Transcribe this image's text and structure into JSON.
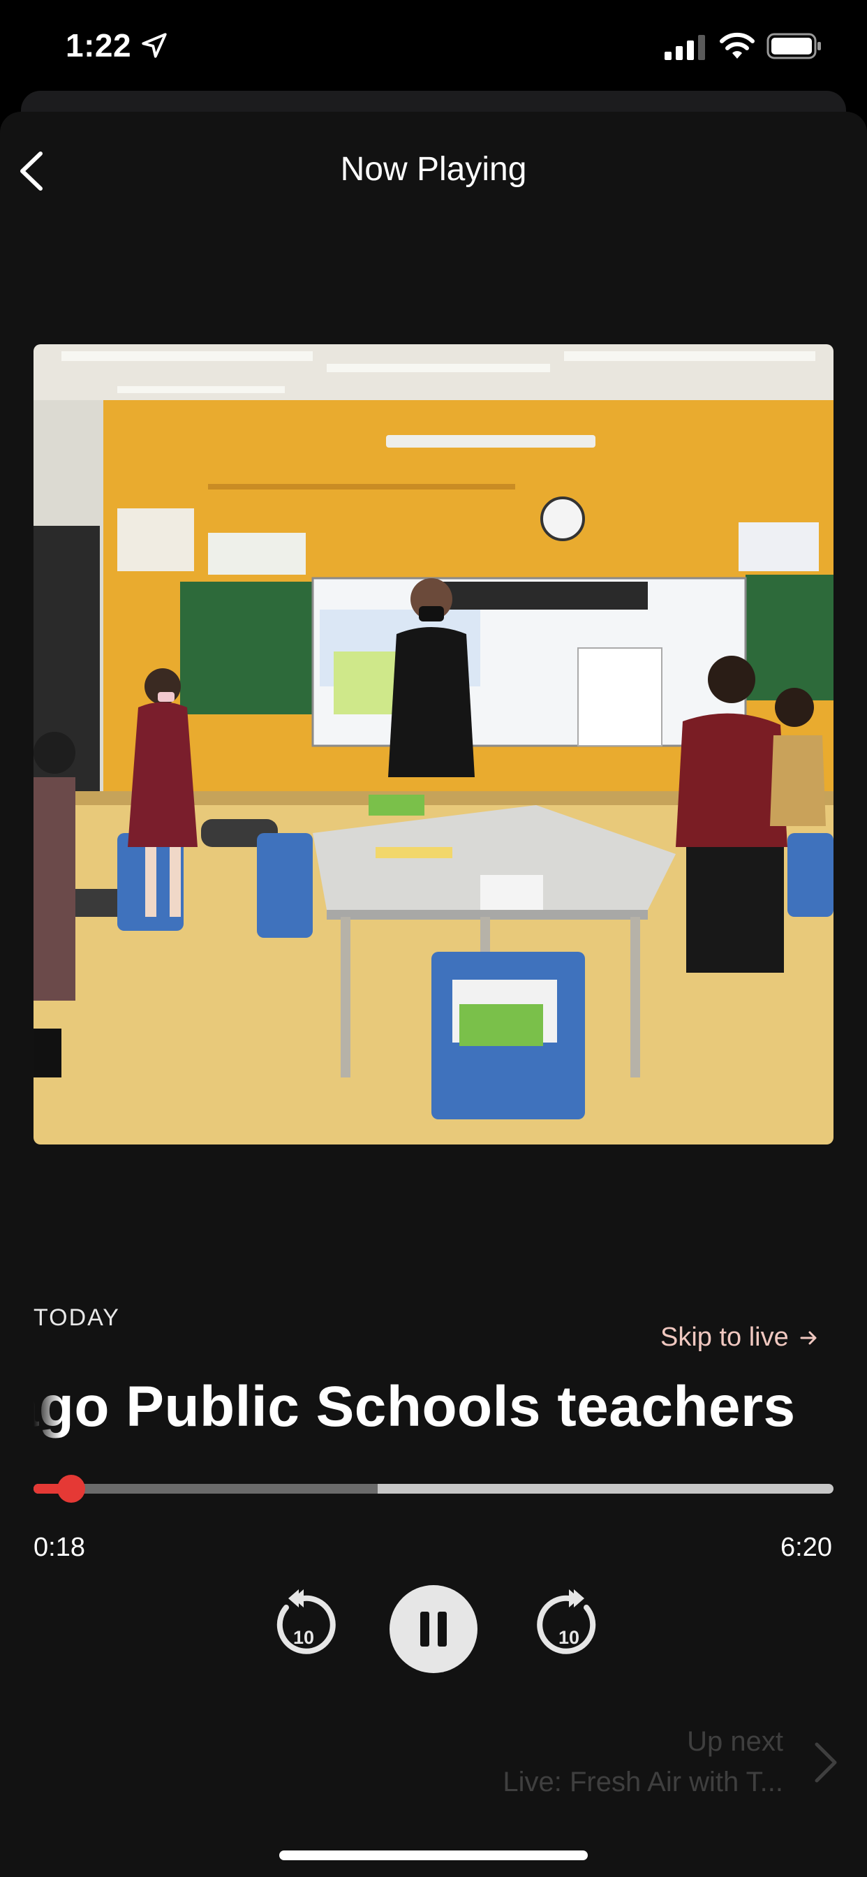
{
  "status_bar": {
    "time": "1:22",
    "icons": [
      "location-arrow-icon",
      "cellular-signal-icon",
      "wifi-icon",
      "battery-icon"
    ]
  },
  "header": {
    "title": "Now Playing",
    "back_icon": "chevron-left-icon"
  },
  "artwork": {
    "subject": "Classroom photo"
  },
  "episode": {
    "date_label": "TODAY",
    "skip_label": "Skip to live",
    "skip_icon": "arrow-right-icon",
    "title": "Chicago Public Schools teachers"
  },
  "progress": {
    "elapsed": "0:18",
    "duration": "6:20",
    "played_fraction": 0.047,
    "buffered_fraction": 0.43
  },
  "controls": {
    "rewind_label": "10",
    "forward_label": "10",
    "rewind_icon": "rewind-10-icon",
    "pause_icon": "pause-icon",
    "forward_icon": "forward-10-icon"
  },
  "up_next": {
    "label": "Up next",
    "title": "Live: Fresh Air with T...",
    "chevron_icon": "chevron-right-icon"
  },
  "colors": {
    "accent": "#e53935",
    "skip_link": "#f0c8c0",
    "background": "#121212"
  }
}
